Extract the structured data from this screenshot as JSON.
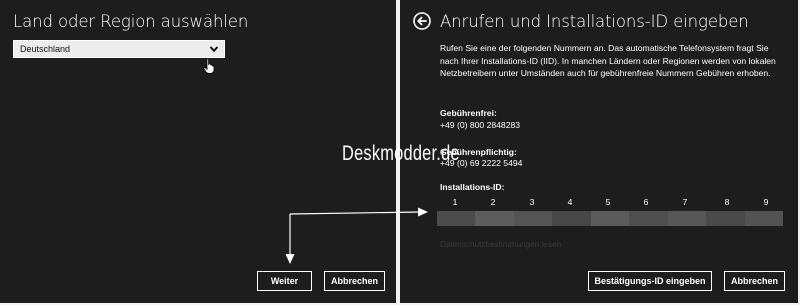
{
  "left": {
    "title": "Land oder Region auswählen",
    "dropdown": {
      "selected": "Deutschland",
      "icon": "chevron-down-icon"
    },
    "buttons": {
      "next": "Weiter",
      "cancel": "Abbrechen"
    }
  },
  "right": {
    "title": "Anrufen und Installations-ID eingeben",
    "back_icon": "back-arrow-icon",
    "description": "Rufen Sie eine der folgenden Nummern an. Das automatische Telefonsystem fragt Sie nach Ihrer Installations-ID (IID). In manchen Ländern oder Regionen werden von lokalen Netzbetreibern unter Umständen auch für gebührenfreie Nummern Gebühren erhoben.",
    "toll_free": {
      "label": "Gebührenfrei:",
      "number": "+49 (0) 800 2848283"
    },
    "toll": {
      "label": "Gebührenpflichtig:",
      "number": "+49 (0) 69 2222 5494"
    },
    "installation_id": {
      "label": "Installations-ID:",
      "groups": [
        "1",
        "2",
        "3",
        "4",
        "5",
        "6",
        "7",
        "8",
        "9"
      ]
    },
    "privacy_link": "Datenschutzbestimmungen lesen",
    "buttons": {
      "confirm": "Bestätigungs-ID eingeben",
      "cancel": "Abbrechen"
    }
  },
  "watermark": "Deskmodder.de",
  "colors": {
    "panel_bg": "#1d1d1d",
    "divider": "#f2f2f2",
    "dropdown_bg": "#ececec",
    "text": "#ffffff",
    "privacy_text": "#3a3a3a"
  }
}
